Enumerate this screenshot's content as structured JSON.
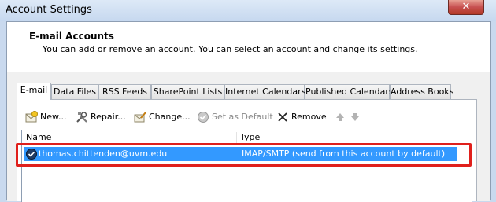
{
  "window": {
    "title": "Account Settings",
    "close_glyph": "✕"
  },
  "header": {
    "title": "E-mail Accounts",
    "description": "You can add or remove an account. You can select an account and change its settings."
  },
  "tabs": [
    {
      "label": "E-mail",
      "active": true
    },
    {
      "label": "Data Files"
    },
    {
      "label": "RSS Feeds"
    },
    {
      "label": "SharePoint Lists"
    },
    {
      "label": "Internet Calendars"
    },
    {
      "label": "Published Calendars"
    },
    {
      "label": "Address Books"
    }
  ],
  "toolbar": {
    "new_label": "New...",
    "repair_label": "Repair...",
    "change_label": "Change...",
    "set_default_label": "Set as Default",
    "remove_label": "Remove"
  },
  "list": {
    "columns": {
      "name": "Name",
      "type": "Type"
    },
    "rows": [
      {
        "name": "thomas.chittenden@uvm.edu",
        "type": "IMAP/SMTP (send from this account by default)",
        "selected": true
      }
    ]
  },
  "colors": {
    "selection": "#3399ff",
    "highlight_box": "#e0201c",
    "close_button": "#c75050"
  }
}
